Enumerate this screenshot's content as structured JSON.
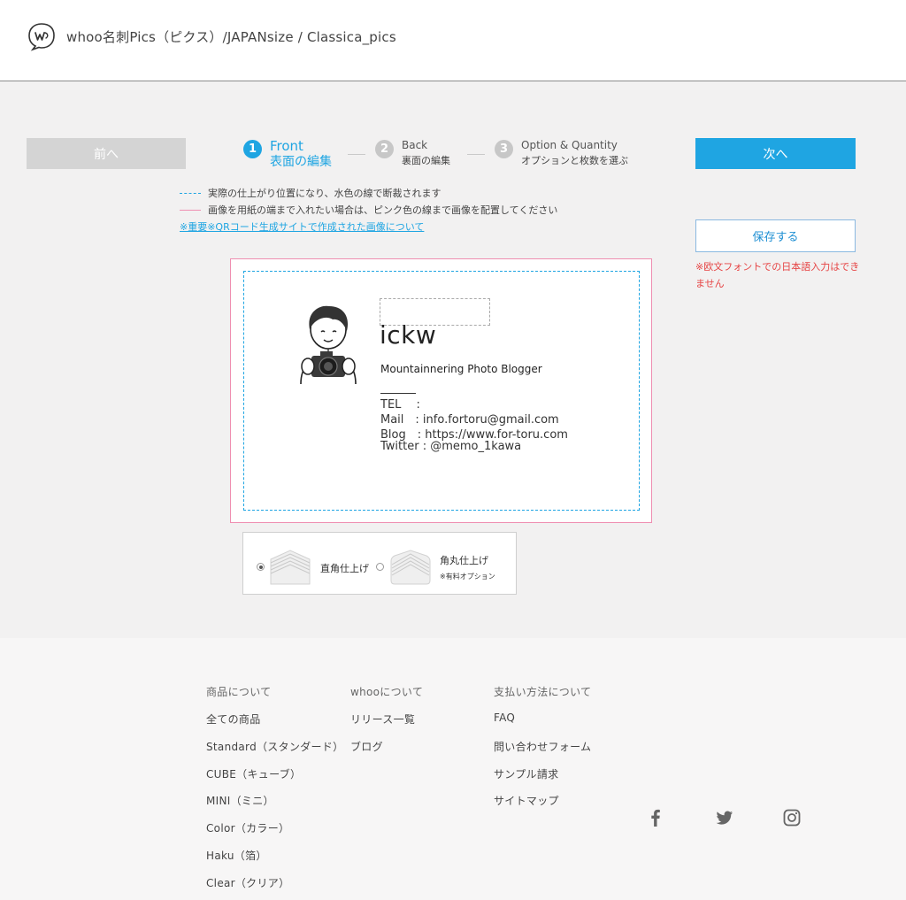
{
  "header": {
    "title": "whoo名刺Pics（ピクス）/JAPANsize / Classica_pics"
  },
  "nav": {
    "prev_label": "前へ",
    "next_label": "次へ",
    "save_label": "保存する"
  },
  "steps": [
    {
      "num": "1",
      "en": "Front",
      "jp": "表面の編集"
    },
    {
      "num": "2",
      "en": "Back",
      "jp": "裏面の編集"
    },
    {
      "num": "3",
      "en": "Option & Quantity",
      "jp": "オプションと枚数を選ぶ"
    }
  ],
  "legend": {
    "cut_line": "実際の仕上がり位置になり、水色の線で断裁されます",
    "bleed_line": "画像を用紙の端まで入れたい場合は、ピンク色の線まで画像を配置してください",
    "qr_link": "※重要※QRコード生成サイトで作成された画像について"
  },
  "warning": "※欧文フォントでの日本語入力はできません",
  "card": {
    "name": "ickw",
    "role": "Mountainnering Photo Blogger",
    "tel": "TEL　 :",
    "mail": "Mail　: info.fortoru@gmail.com",
    "blog": "Blog　: https://www.for-toru.com",
    "twitter": "Twitter : @memo_1kawa"
  },
  "finish": {
    "square_label": "直角仕上げ",
    "round_label": "角丸仕上げ",
    "round_note": "※有料オプション",
    "selected": "square"
  },
  "footer": {
    "col1": [
      "商品について",
      "全ての商品",
      "Standard（スタンダード）",
      "CUBE（キューブ）",
      "MINI（ミニ）",
      "Color（カラー）",
      "Haku（箔）",
      "Clear（クリア）"
    ],
    "col2": [
      "whooについて",
      "リリース一覧",
      "ブログ"
    ],
    "col3": [
      "支払い方法について",
      "FAQ",
      "問い合わせフォーム",
      "サンプル請求",
      "サイトマップ"
    ],
    "social": [
      "facebook-icon",
      "twitter-icon",
      "instagram-icon"
    ]
  },
  "colors": {
    "accent": "#1fa5e2",
    "bleed": "#ef8fb1",
    "warning": "#e64444"
  }
}
